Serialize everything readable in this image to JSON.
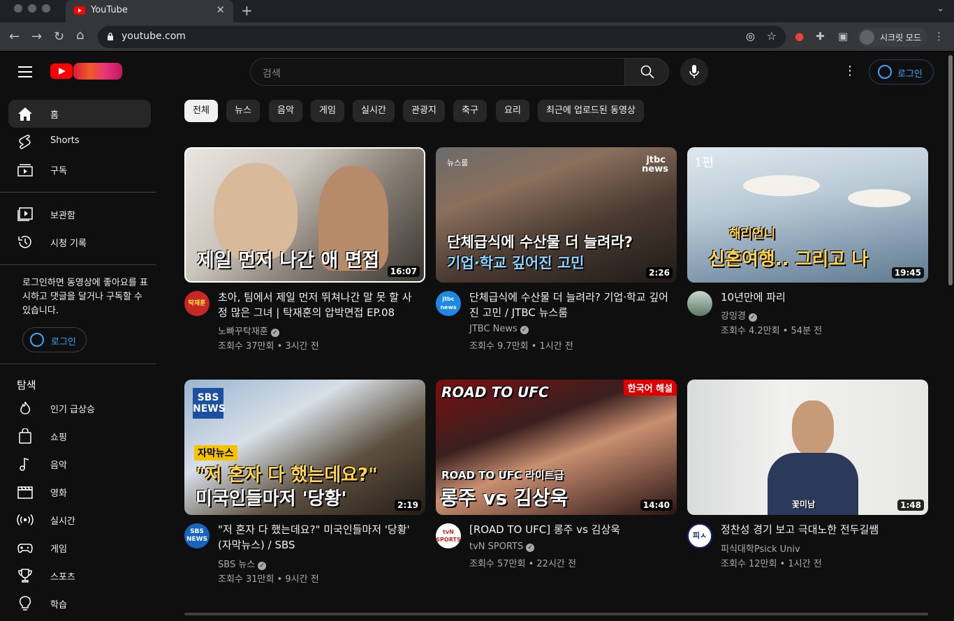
{
  "browser": {
    "tab_title": "YouTube",
    "url": "youtube.com",
    "incognito_label": "시크릿 모드"
  },
  "header": {
    "search_placeholder": "검색",
    "login_label": "로그인"
  },
  "sidebar": {
    "main": [
      {
        "label": "홈",
        "icon": "home-icon"
      },
      {
        "label": "Shorts",
        "icon": "shorts-icon"
      },
      {
        "label": "구독",
        "icon": "subscriptions-icon"
      }
    ],
    "library": [
      {
        "label": "보관함",
        "icon": "library-icon"
      },
      {
        "label": "시청 기록",
        "icon": "history-icon"
      }
    ],
    "promo_text": "로그인하면 동영상에 좋아요를 표시하고 댓글을 달거나 구독할 수 있습니다.",
    "promo_login": "로그인",
    "explore_title": "탐색",
    "explore": [
      {
        "label": "인기 급상승",
        "icon": "trending-icon"
      },
      {
        "label": "쇼핑",
        "icon": "shopping-bag-icon"
      },
      {
        "label": "음악",
        "icon": "music-note-icon"
      },
      {
        "label": "영화",
        "icon": "clapperboard-icon"
      },
      {
        "label": "실시간",
        "icon": "live-icon"
      },
      {
        "label": "게임",
        "icon": "gamepad-icon"
      },
      {
        "label": "스포츠",
        "icon": "trophy-icon"
      },
      {
        "label": "학습",
        "icon": "lightbulb-icon"
      }
    ]
  },
  "chips": [
    "전체",
    "뉴스",
    "음악",
    "게임",
    "실시간",
    "관광지",
    "축구",
    "요리",
    "최근에 업로드된 동영상"
  ],
  "videos": [
    {
      "title": "초아, 팀에서 제일 먼저 뛰쳐나간 말 못 할 사정 많은 그녀 | 탁재훈의 압박면접 EP.08",
      "channel": "노빠꾸탁재훈",
      "verified": true,
      "meta": "조회수 37만회 • 3시간 전",
      "duration": "16:07",
      "thumb_text": "제일 먼저 나간 애 면접",
      "thumb_tag": "",
      "avatar_text": "탁재훈"
    },
    {
      "title": "단체급식에 수산물 더 늘려라? 기업·학교 깊어진 고민 / JTBC 뉴스룸",
      "channel": "JTBC News",
      "verified": true,
      "meta": "조회수 9.7만회 • 1시간 전",
      "duration": "2:26",
      "thumb_text": "단체급식에 수산물 더 늘려라?",
      "thumb_text2": "기업·학교 깊어진 고민",
      "thumb_tag": "뉴스룸",
      "thumb_logo": "jtbc news",
      "avatar_text": "jtbc news"
    },
    {
      "title": "10년만에 파리",
      "channel": "강밍경",
      "verified": true,
      "meta": "조회수 4.2만회 • 54분 전",
      "duration": "19:45",
      "thumb_text": "신혼여행.. 그리고 나",
      "thumb_text2": "해리언니",
      "thumb_tag": "1편",
      "avatar_text": ""
    },
    {
      "title": "\"저 혼자 다 했는데요?\" 미국인들마저 '당황' (자막뉴스) / SBS",
      "channel": "SBS 뉴스",
      "verified": true,
      "meta": "조회수 31만회 • 9시간 전",
      "duration": "2:19",
      "thumb_text": "\"저 혼자 다 했는데요?\"",
      "thumb_text2": "미국인들마저 '당황'",
      "thumb_tag": "자막뉴스",
      "thumb_logo": "SBS NEWS",
      "avatar_text": "SBS NEWS"
    },
    {
      "title": "[ROAD TO UFC] 롱주 vs 김상욱",
      "channel": "tvN SPORTS",
      "verified": true,
      "meta": "조회수 57만회 • 22시간 전",
      "duration": "14:40",
      "thumb_text": "롱주 vs 김상욱",
      "thumb_text2": "ROAD TO UFC 라이트급",
      "thumb_tag": "한국어 해설",
      "thumb_logo": "ROAD TO UFC",
      "avatar_text": "tvN SPORTS"
    },
    {
      "title": "정찬성 경기 보고 극대노한 전두길쌤",
      "channel": "피식대학Psick Univ",
      "verified": false,
      "meta": "조회수 12만회 • 1시간 전",
      "duration": "1:48",
      "thumb_text": "꽃미남",
      "thumb_tag": "",
      "avatar_text": "피ㅅ"
    }
  ],
  "colors": {
    "accent": "#3ea6ff",
    "brand": "#ff0000",
    "bg": "#0f0f0f"
  }
}
